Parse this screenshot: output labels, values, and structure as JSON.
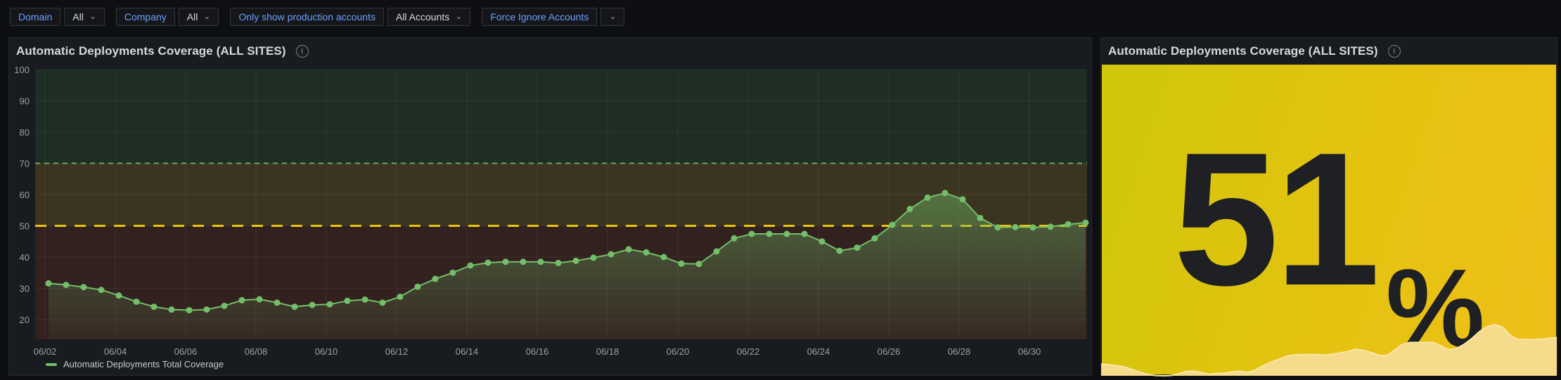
{
  "toolbar": {
    "filters": [
      {
        "label": "Domain",
        "value": "All"
      },
      {
        "label": "Company",
        "value": "All"
      },
      {
        "label": "Only show production accounts",
        "value": "All Accounts"
      },
      {
        "label": "Force Ignore Accounts",
        "value": ""
      }
    ]
  },
  "panels": {
    "timeseries": {
      "title": "Automatic Deployments Coverage (ALL SITES)"
    },
    "stat": {
      "title": "Automatic Deployments Coverage (ALL SITES)",
      "value": "51",
      "unit": "%"
    }
  },
  "colors": {
    "page_bg": "#0e0f13",
    "panel_bg": "#181b1f",
    "accent_blue": "#6e9fff",
    "text_primary": "#d8d9da",
    "text_secondary": "#9da0a6",
    "series_green": "#73bf69",
    "threshold_yellow": "#f2cc0c",
    "band_green": "#1e2e24",
    "band_olive": "#3a3420",
    "band_maroon": "#33211f",
    "grid": "rgba(204,204,220,0.08)",
    "stat_text": "#1e2024",
    "spark_fill": "#f5db8b",
    "spark_stroke": "#fbe7a5"
  },
  "chart_data": [
    {
      "type": "line",
      "title": "Automatic Deployments Coverage (ALL SITES)",
      "xlabel": "",
      "ylabel": "",
      "x_tick_labels": [
        "06/02",
        "06/04",
        "06/06",
        "06/08",
        "06/10",
        "06/12",
        "06/14",
        "06/16",
        "06/18",
        "06/20",
        "06/22",
        "06/24",
        "06/26",
        "06/28",
        "06/30"
      ],
      "x_tick_interval_days": 2,
      "points_per_day": 2,
      "y_ticks": [
        20,
        30,
        40,
        50,
        60,
        70,
        80,
        90,
        100
      ],
      "ylim": [
        13.7,
        100
      ],
      "grid": true,
      "legend_position": "bottom-left",
      "thresholds": [
        {
          "value": 70,
          "color": "#73bf69",
          "style": "dashed"
        },
        {
          "value": 50,
          "color": "#f2cc0c",
          "style": "dashed"
        }
      ],
      "bands": [
        {
          "from": 70,
          "to": 100,
          "color": "#1e2e24"
        },
        {
          "from": 50,
          "to": 70,
          "color": "#3a3420"
        },
        {
          "from": 13.7,
          "to": 50,
          "color": "#33211f"
        }
      ],
      "series": [
        {
          "name": "Automatic Deployments Total Coverage",
          "color": "#73bf69",
          "values": [
            31.6,
            31.1,
            30.4,
            29.5,
            27.7,
            25.7,
            24.1,
            23.2,
            23,
            23.2,
            24.4,
            26.2,
            26.5,
            25.4,
            24.1,
            24.7,
            24.9,
            26,
            26.4,
            25.4,
            27.3,
            30.5,
            33,
            35,
            37.3,
            38.2,
            38.5,
            38.5,
            38.5,
            38.1,
            38.8,
            39.8,
            40.9,
            42.5,
            41.5,
            40,
            37.9,
            37.8,
            41.8,
            46,
            47.4,
            47.4,
            47.4,
            47.4,
            45,
            42,
            43,
            46,
            50.3,
            55.4,
            59,
            60.5,
            58.5,
            52.5,
            49.5,
            49.6,
            49.5,
            49.7,
            50.5,
            51
          ]
        }
      ]
    },
    {
      "type": "stat",
      "title": "Automatic Deployments Coverage (ALL SITES)",
      "value": 51,
      "unit": "%",
      "sparkline_of_series": "Automatic Deployments Total Coverage"
    }
  ]
}
